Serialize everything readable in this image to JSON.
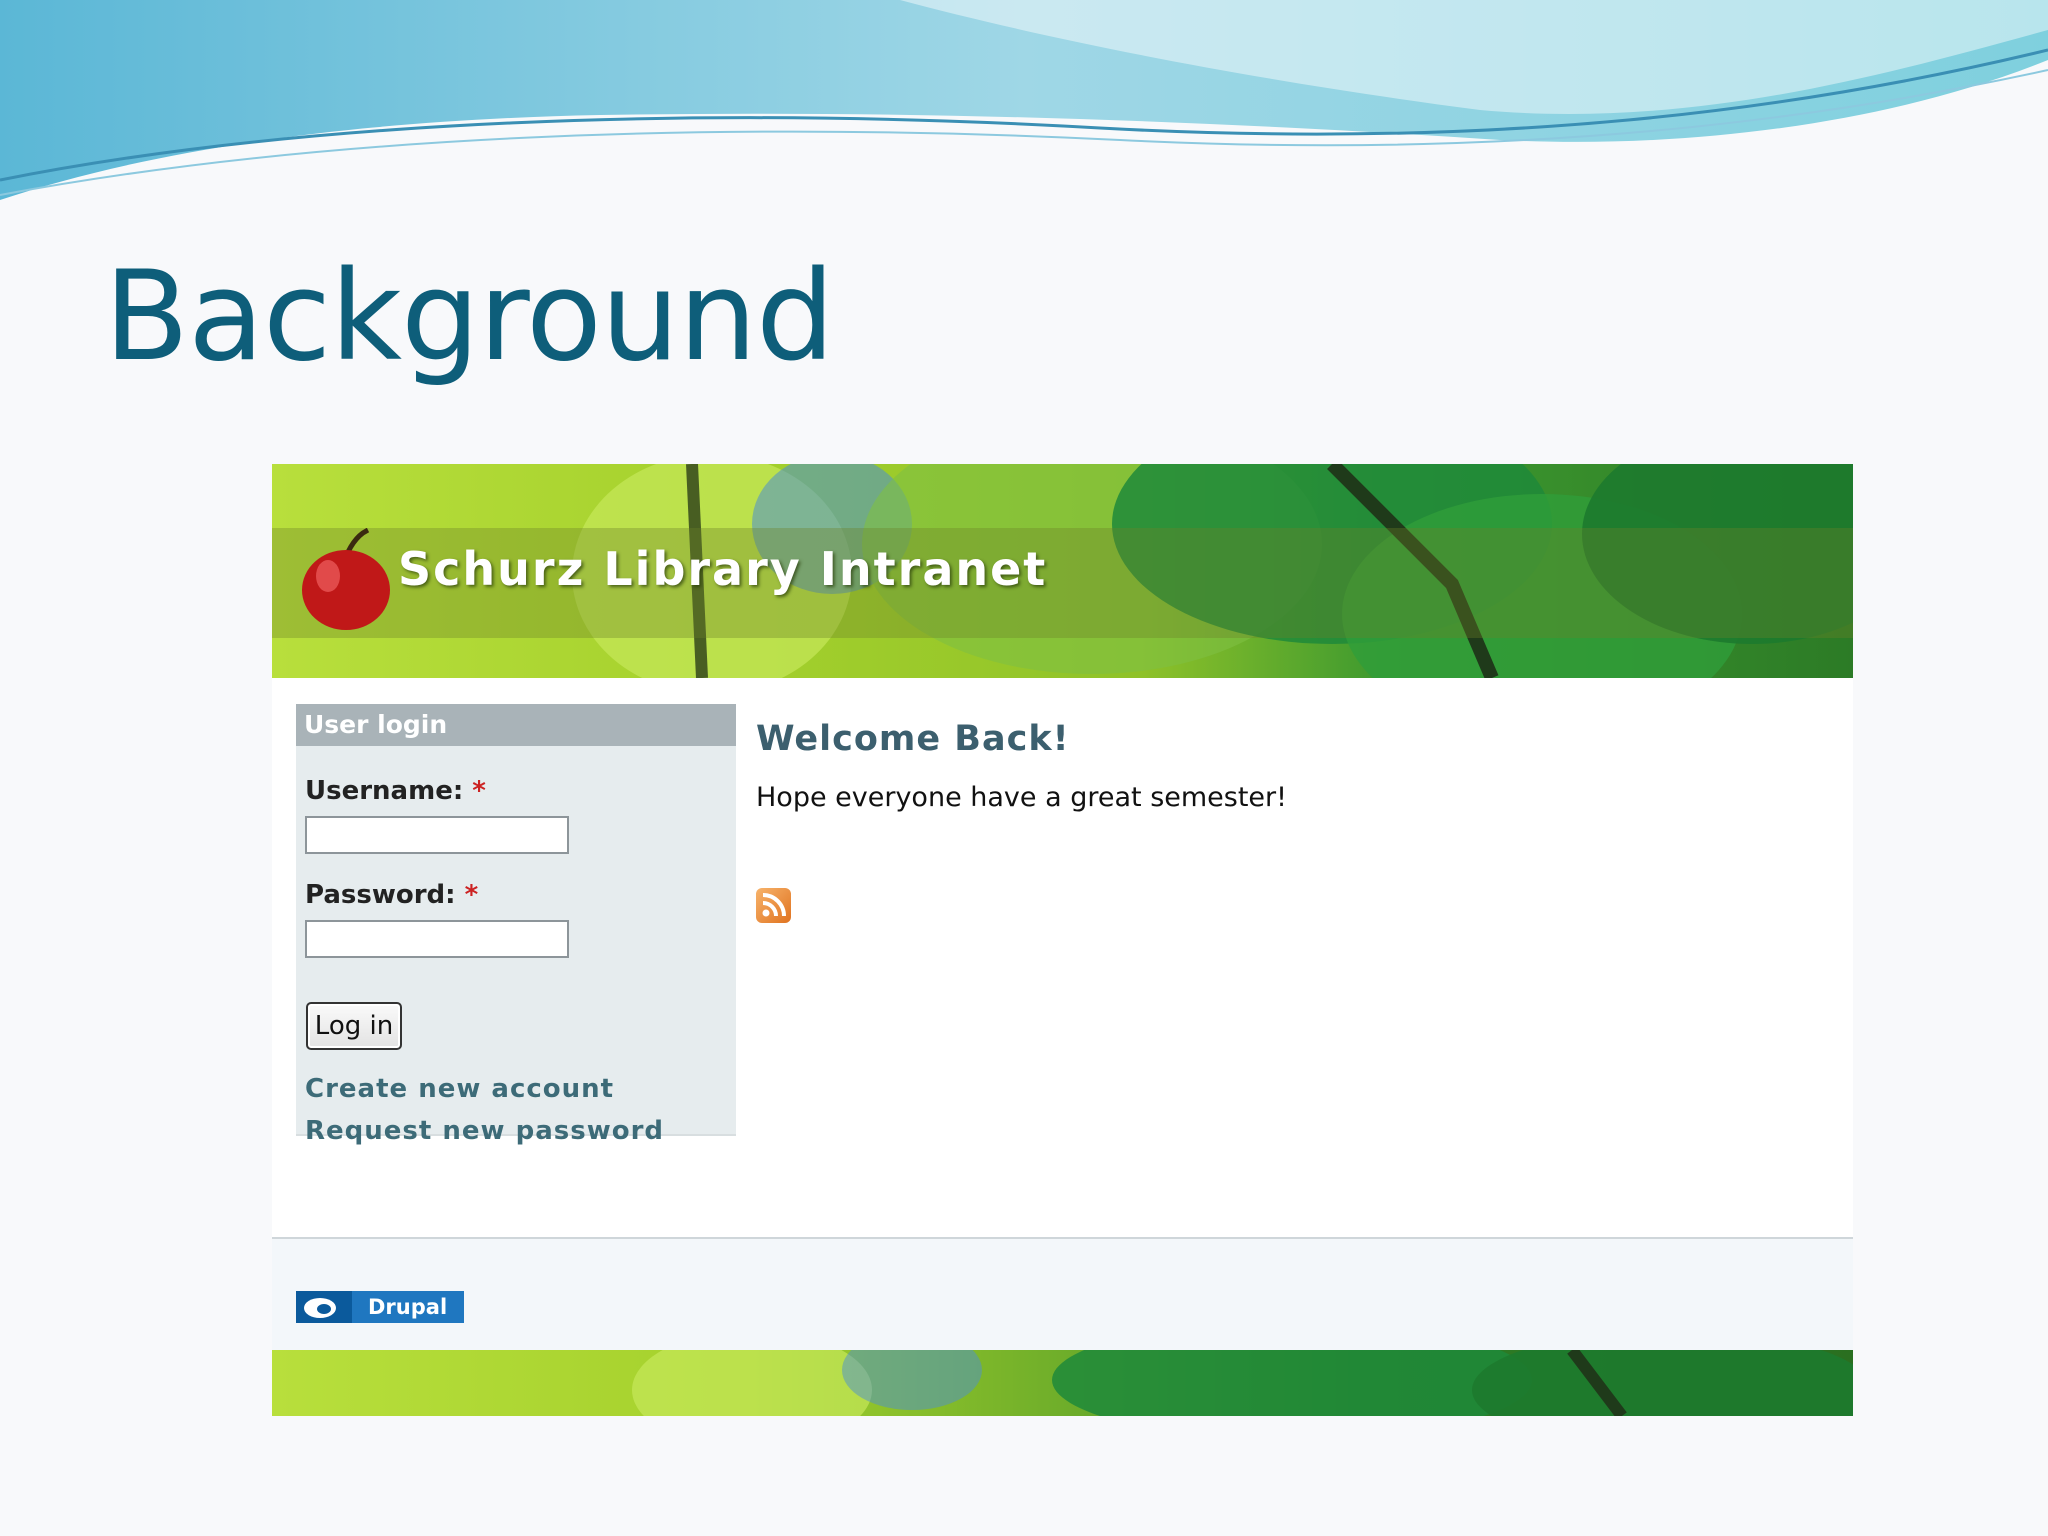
{
  "slide": {
    "title": "Background"
  },
  "site": {
    "name": "Schurz Library Intranet"
  },
  "login": {
    "block_title": "User login",
    "username_label": "Username:",
    "password_label": "Password:",
    "required_marker": "*",
    "username_value": "",
    "password_value": "",
    "submit_label": "Log in",
    "links": [
      "Create new account",
      "Request new password"
    ]
  },
  "content": {
    "heading": "Welcome Back!",
    "message": "Hope everyone have a great semester!",
    "feed_icon": "rss-icon"
  },
  "footer": {
    "powered_by": "Drupal"
  },
  "colors": {
    "title": "#0e5e7a",
    "link": "#3d6b78",
    "sidebar_bg": "#e6ecee",
    "block_header": "#a9b3b8",
    "drupal": "#1f77c0"
  }
}
